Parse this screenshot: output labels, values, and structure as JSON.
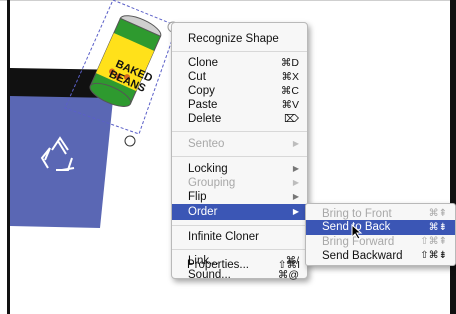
{
  "menu": {
    "items": [
      {
        "label": "Recognize Shape",
        "shortcut": "",
        "state": "enabled",
        "submenu": false
      },
      {
        "label": "Clone",
        "shortcut": "⌘D",
        "state": "enabled",
        "submenu": false
      },
      {
        "label": "Cut",
        "shortcut": "⌘X",
        "state": "enabled",
        "submenu": false
      },
      {
        "label": "Copy",
        "shortcut": "⌘C",
        "state": "enabled",
        "submenu": false
      },
      {
        "label": "Paste",
        "shortcut": "⌘V",
        "state": "enabled",
        "submenu": false
      },
      {
        "label": "Delete",
        "shortcut": "⌦",
        "state": "enabled",
        "submenu": false
      },
      {
        "label": "Senteo",
        "shortcut": "",
        "state": "disabled",
        "submenu": true
      },
      {
        "label": "Locking",
        "shortcut": "",
        "state": "enabled",
        "submenu": true
      },
      {
        "label": "Grouping",
        "shortcut": "",
        "state": "disabled",
        "submenu": true
      },
      {
        "label": "Flip",
        "shortcut": "",
        "state": "enabled",
        "submenu": true
      },
      {
        "label": "Order",
        "shortcut": "",
        "state": "highlighted",
        "submenu": true
      },
      {
        "label": "Infinite Cloner",
        "shortcut": "",
        "state": "enabled",
        "submenu": false
      },
      {
        "label": "Link...",
        "shortcut": "⌘/",
        "state": "enabled",
        "submenu": false
      },
      {
        "label": "Sound...",
        "shortcut": "⌘@",
        "state": "enabled",
        "submenu": false
      },
      {
        "label": "Properties...",
        "shortcut": "⇧⌘I",
        "state": "enabled",
        "submenu": false
      }
    ]
  },
  "submenu": {
    "items": [
      {
        "label": "Bring to Front",
        "shortcut": "⌘⇞",
        "state": "disabled"
      },
      {
        "label": "Send to Back",
        "shortcut": "⌘⇟",
        "state": "highlighted"
      },
      {
        "label": "Bring Forward",
        "shortcut": "⇧⌘⇞",
        "state": "disabled"
      },
      {
        "label": "Send Backward",
        "shortcut": "⇧⌘⇟",
        "state": "enabled"
      }
    ]
  },
  "can": {
    "label_line1": "BAKED",
    "label_line2": "BEANS"
  },
  "colors": {
    "highlight": "#3b56b5",
    "bin": "#5a67b4",
    "bin_rim": "#111111",
    "can_green": "#2e9a2f",
    "can_yellow": "#ffe11a",
    "selection": "#5a5fc8"
  }
}
